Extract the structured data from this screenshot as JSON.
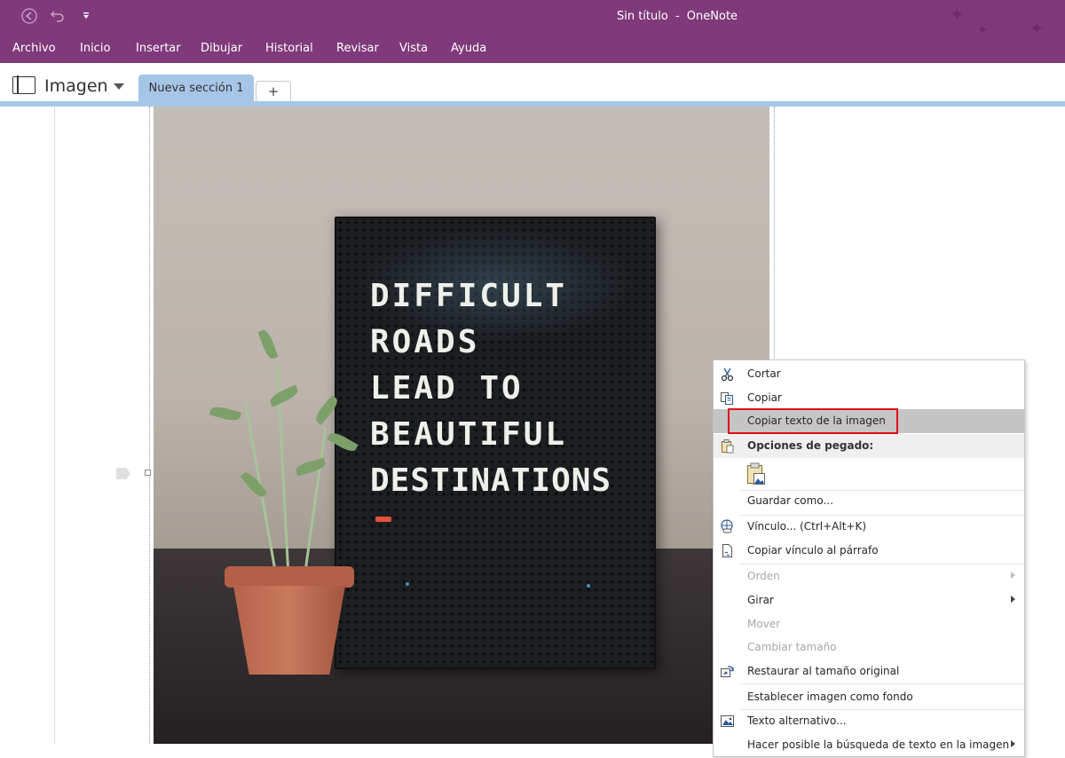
{
  "window": {
    "title": "Sin título",
    "separator": "-",
    "app_name": "OneNote"
  },
  "ribbon": {
    "tabs": [
      "Archivo",
      "Inicio",
      "Insertar",
      "Dibujar",
      "Historial",
      "Revisar",
      "Vista",
      "Ayuda"
    ]
  },
  "notebook": {
    "name": "Imagen"
  },
  "sections": {
    "active": "Nueva sección 1",
    "add_label": "+"
  },
  "image": {
    "board_lines": [
      "DIFFICULT",
      "ROADS",
      "LEAD TO",
      "BEAUTIFUL",
      "DESTINATIONS"
    ]
  },
  "context_menu": {
    "items": [
      {
        "label": "Cortar",
        "icon": "scissors-icon"
      },
      {
        "label": "Copiar",
        "icon": "copy-icon"
      },
      {
        "label": "Copiar texto de la imagen",
        "highlighted": true
      },
      {
        "label": "Opciones de pegado:",
        "icon": "clipboard-icon"
      },
      {
        "label": "Guardar como..."
      },
      {
        "label": "Vínculo...  (Ctrl+Alt+K)",
        "icon": "link-icon"
      },
      {
        "label": "Copiar vínculo al párrafo",
        "icon": "link-page-icon"
      },
      {
        "label": "Orden",
        "disabled": true
      },
      {
        "label": "Girar"
      },
      {
        "label": "Mover",
        "disabled": true
      },
      {
        "label": "Cambiar tamaño",
        "disabled": true
      },
      {
        "label": "Restaurar al tamaño original",
        "icon": "restore-size-icon"
      },
      {
        "label": "Establecer imagen como fondo"
      },
      {
        "label": "Texto alternativo...",
        "icon": "alt-text-icon"
      },
      {
        "label": "Hacer posible la búsqueda de texto en la imagen"
      }
    ],
    "highlight_color": "#c5c5c5",
    "callout_color": "#e0101a"
  },
  "colors": {
    "titlebar": "#80397b",
    "section_tab": "#a6c6e8"
  }
}
